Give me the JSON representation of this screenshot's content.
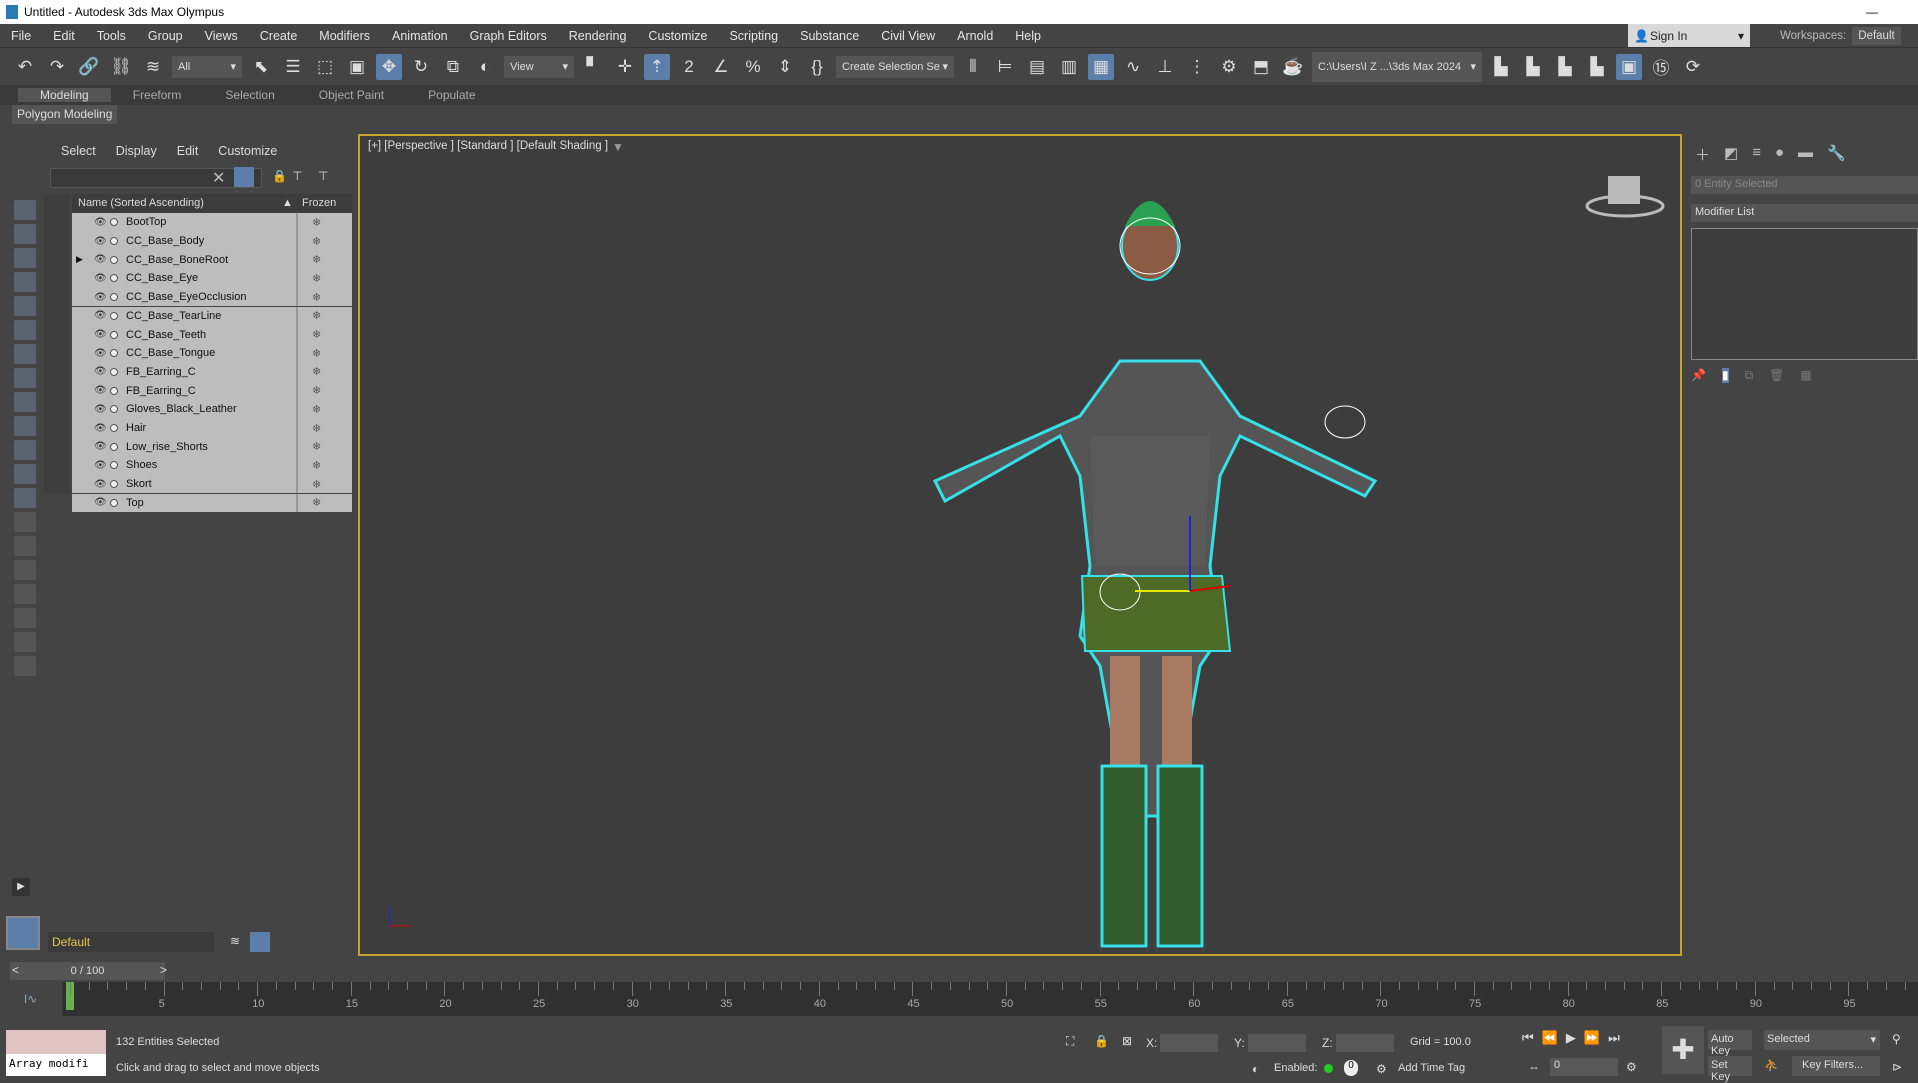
{
  "window": {
    "title": "Untitled - Autodesk 3ds Max Olympus"
  },
  "menu": [
    "File",
    "Edit",
    "Tools",
    "Group",
    "Views",
    "Create",
    "Modifiers",
    "Animation",
    "Graph Editors",
    "Rendering",
    "Customize",
    "Scripting",
    "Substance",
    "Civil View",
    "Arnold",
    "Help"
  ],
  "account": {
    "sign_in": "Sign In",
    "workspaces_label": "Workspaces:",
    "workspace": "Default"
  },
  "toolbar": {
    "filter": "All",
    "ref_coord": "View",
    "selection_set": "Create Selection Se",
    "project_path": "C:\\Users\\I Z ...\\3ds Max 2024"
  },
  "ribbon": {
    "tabs": [
      "Modeling",
      "Freeform",
      "Selection",
      "Object Paint",
      "Populate"
    ],
    "panel": "Polygon Modeling"
  },
  "explorer": {
    "menu": [
      "Select",
      "Display",
      "Edit",
      "Customize"
    ],
    "col_name": "Name (Sorted Ascending)",
    "col_frozen": "Frozen",
    "items": [
      "BootTop",
      "CC_Base_Body",
      "CC_Base_BoneRoot",
      "CC_Base_Eye",
      "CC_Base_EyeOcclusion",
      "CC_Base_TearLine",
      "CC_Base_Teeth",
      "CC_Base_Tongue",
      "FB_Earring_C",
      "FB_Earring_C",
      "Gloves_Black_Leather",
      "Hair",
      "Low_rise_Shorts",
      "Shoes",
      "Skort",
      "Top"
    ],
    "layer": "Default"
  },
  "viewport": {
    "label": "[+] [Perspective ] [Standard ] [Default Shading ]"
  },
  "command_panel": {
    "selection": "0 Entity Selected",
    "modifier_list": "Modifier List"
  },
  "timeline": {
    "frame": "0 / 100",
    "ticks": [
      "5",
      "10",
      "15",
      "20",
      "25",
      "30",
      "35",
      "40",
      "45",
      "50",
      "55",
      "60",
      "65",
      "70",
      "75",
      "80",
      "85",
      "90",
      "95"
    ]
  },
  "status": {
    "selected": "132 Entities Selected",
    "prompt": "Click and drag to select and move objects",
    "script": "Array modifi",
    "x_label": "X:",
    "y_label": "Y:",
    "z_label": "Z:",
    "grid": "Grid = 100.0",
    "enabled": "Enabled:",
    "add_time_tag": "Add Time Tag",
    "auto_key": "Auto Key",
    "set_key": "Set Key",
    "key_mode": "Selected",
    "key_filters": "Key Filters...",
    "frame_input": "0"
  }
}
